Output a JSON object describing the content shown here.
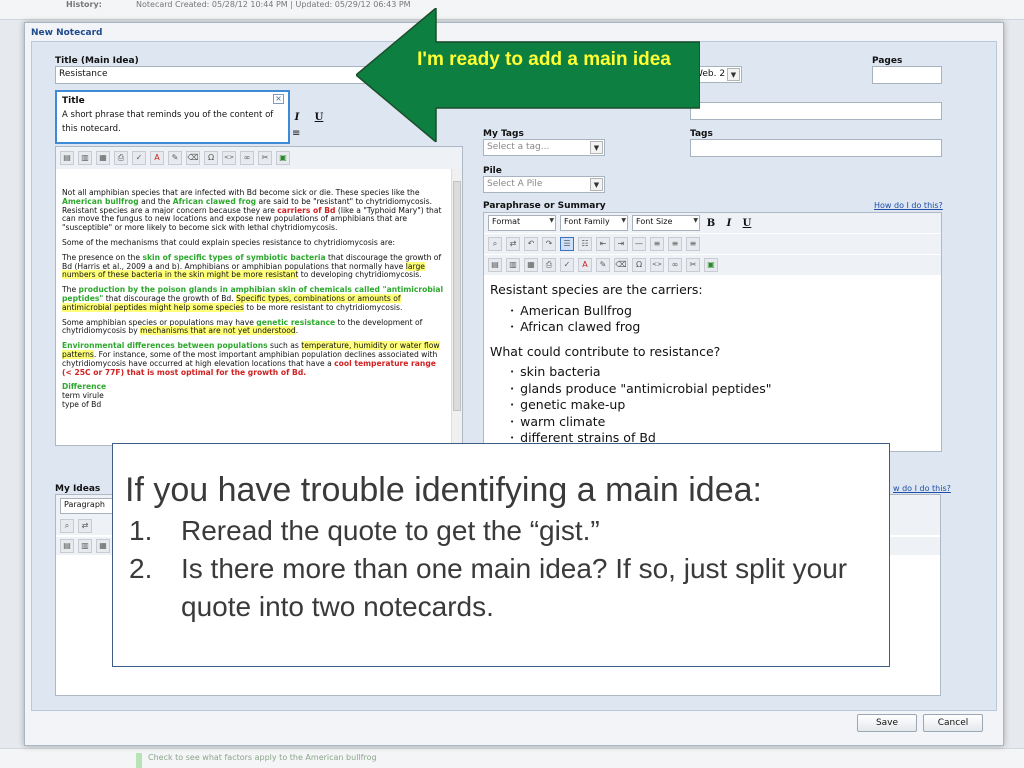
{
  "background": {
    "history_label": "History:",
    "history_text": "Notecard Created: 05/28/12 10:44 PM | Updated: 05/29/12 06:43 PM",
    "bottom_hint": "Check to see what factors apply to the American bullfrog"
  },
  "dialog": {
    "title": "New Notecard",
    "title_label": "Title (Main Idea)",
    "title_value": "Resistance",
    "source_select_value": "Web. 2",
    "pages_label": "Pages",
    "my_tags_label": "My Tags",
    "my_tags_placeholder": "Select a tag...",
    "tags_label": "Tags",
    "pile_label": "Pile",
    "pile_placeholder": "Select A Pile",
    "paraphrase_label": "Paraphrase or Summary",
    "how_do_i_link": "How do I do this?",
    "how_do_i_link_2": "w do I do this?",
    "my_ideas_label": "My Ideas",
    "my_ideas_format": "Paragraph",
    "save_label": "Save",
    "cancel_label": "Cancel"
  },
  "toolbar": {
    "format_label": "Format",
    "font_family_label": "Font Family",
    "font_size_label": "Font Size",
    "bold": "B",
    "italic": "I",
    "underline": "U"
  },
  "tooltip": {
    "title": "Title",
    "body": "A short phrase that reminds you of the content of this notecard.",
    "close": "×"
  },
  "quote": {
    "p1_a": "Not all amphibian species that are infected with Bd become sick or die. These species like the ",
    "p1_b": "American bullfrog",
    "p1_c": " and the ",
    "p1_d": "African clawed frog",
    "p1_e": " are said to be \"resistant\" to chytridiomycosis. Resistant species are a major concern because they are ",
    "p1_f": "carriers of Bd",
    "p1_g": " (like a \"Typhoid Mary\") that can move the fungus to new locations and expose new populations of amphibians that are \"susceptible\" or more likely to become sick with lethal chytridiomycosis.",
    "p2": "Some of the mechanisms that could explain species resistance to chytridiomycosis are:",
    "p3_a": "The presence on the ",
    "p3_b": "skin of specific types of symbiotic bacteria",
    "p3_c": " that discourage the growth of Bd (Harris et al., 2009 a and b). Amphibians or amphibian populations that normally have ",
    "p3_d": "large numbers of these bacteria in the skin might be more resistant",
    "p3_e": " to developing chytridiomycosis.",
    "p4_a": "The ",
    "p4_b": "production by the poison glands in amphibian skin of chemicals called \"antimicrobial peptides\"",
    "p4_c": " that discourage the growth of Bd. ",
    "p4_d": "Specific types, combinations or amounts of antimicrobial peptides might help some species",
    "p4_e": " to be more resistant to chytridiomycosis.",
    "p5_a": "Some amphibian species or populations may have ",
    "p5_b": "genetic resistance",
    "p5_c": " to the development of chytridiomycosis by ",
    "p5_d": "mechanisms that are not yet understood",
    "p5_e": ".",
    "p6_a": "Environmental differences between populations",
    "p6_b": " such as ",
    "p6_c": "temperature, humidity or water flow patterns",
    "p6_d": ". For instance, some of the most important amphibian population declines associated with chytridiomycosis have occurred at high elevation locations that have a ",
    "p6_e": "cool temperature range (< 25C or 77F) that is most optimal for the growth of Bd.",
    "p7_a": "Difference",
    "p7_b": "term virule",
    "p7_c": "type of Bd"
  },
  "paraphrase": {
    "heading1": "Resistant species are the carriers:",
    "list1": [
      "American Bullfrog",
      "African clawed frog"
    ],
    "heading2": "What could contribute to resistance?",
    "list2": [
      "skin bacteria",
      "glands produce \"antimicrobial peptides\"",
      "genetic make-up",
      "warm climate",
      "different strains of Bd"
    ]
  },
  "arrow": {
    "text": "I'm ready to add a main idea",
    "fill_color": "#0d7f41",
    "text_color": "#ffff33"
  },
  "callout": {
    "heading": "If you have trouble identifying a main idea:",
    "items": [
      {
        "num": "1.",
        "text": "Reread the quote to get the “gist.”"
      },
      {
        "num": "2.",
        "text": "Is there more than one main idea? If so, just split your quote into two notecards."
      }
    ]
  }
}
